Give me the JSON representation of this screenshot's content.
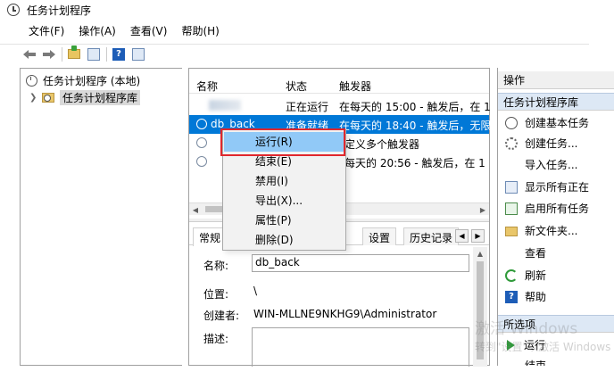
{
  "window": {
    "title": "任务计划程序"
  },
  "menubar": [
    "文件(F)",
    "操作(A)",
    "查看(V)",
    "帮助(H)"
  ],
  "toolbar": {
    "back_icon": "arrow-left-icon",
    "forward_icon": "arrow-right-icon",
    "help_glyph": "?"
  },
  "tree": {
    "root": "任务计划程序 (本地)",
    "library": "任务计划程序库"
  },
  "task_list": {
    "columns": [
      "名称",
      "状态",
      "触发器"
    ],
    "rows": [
      {
        "name": "",
        "status": "正在运行",
        "trigger": "在每天的 15:00 - 触发后，在 1"
      },
      {
        "name": "db_back",
        "status": "准备就绪",
        "trigger": "在每天的 18:40 - 触发后，无限"
      },
      {
        "name": "",
        "status": "",
        "trigger": "已定义多个触发器"
      },
      {
        "name": "",
        "status": "",
        "trigger": "在每天的 20:56 - 触发后，在 1"
      }
    ],
    "selected_index": 1
  },
  "detail": {
    "tabs": [
      "常规",
      "设置",
      "历史记录"
    ],
    "name_label": "名称:",
    "name_value": "db_back",
    "location_label": "位置:",
    "location_value": "\\",
    "author_label": "创建者:",
    "author_value": "WIN-MLLNE9NKHG9\\Administrator",
    "desc_label": "描述:"
  },
  "context_menu": {
    "items": [
      "运行(R)",
      "结束(E)",
      "禁用(I)",
      "导出(X)...",
      "属性(P)",
      "删除(D)"
    ],
    "highlighted_index": 0
  },
  "actions": {
    "header": "操作",
    "section1": "任务计划程序库",
    "items1": [
      {
        "label": "创建基本任务",
        "icon": "clock-icon"
      },
      {
        "label": "创建任务...",
        "icon": "gear-icon"
      },
      {
        "label": "导入任务...",
        "icon": ""
      },
      {
        "label": "显示所有正在",
        "icon": "list-icon"
      },
      {
        "label": "启用所有任务",
        "icon": "check-list-icon"
      },
      {
        "label": "新文件夹...",
        "icon": "folder-icon"
      },
      {
        "label": "查看",
        "icon": ""
      },
      {
        "label": "刷新",
        "icon": "refresh-icon"
      },
      {
        "label": "帮助",
        "icon": "help-icon"
      }
    ],
    "section2": "所选项",
    "items2": [
      {
        "label": "运行",
        "icon": "run-icon"
      },
      {
        "label": "结束",
        "icon": ""
      }
    ]
  },
  "watermark": {
    "line1": "激活 Windows",
    "line2": "转到\"设置\"以激活 Windows"
  },
  "colors": {
    "selection": "#0078d7",
    "menu_hover": "#91c9f7",
    "highlight_box": "#e0272d"
  }
}
